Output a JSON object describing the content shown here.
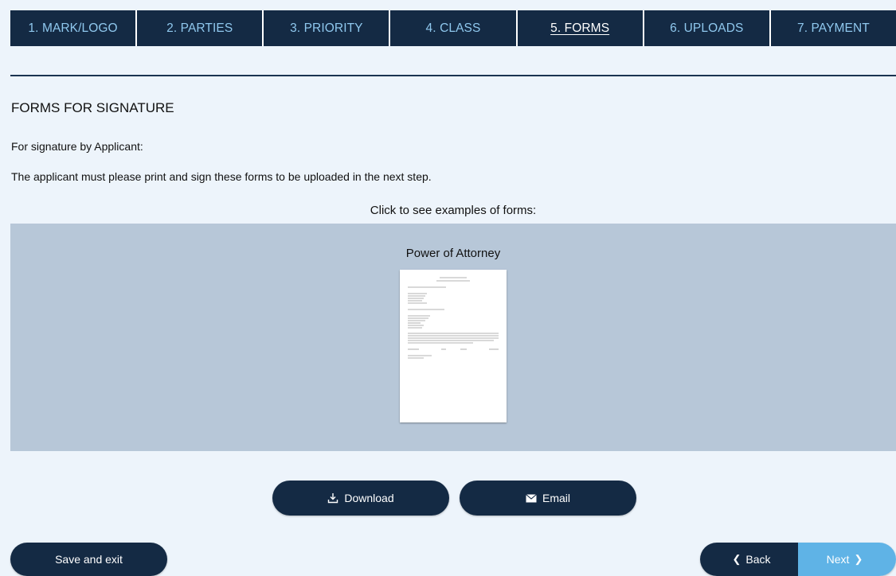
{
  "tabs": [
    {
      "label": "1. MARK/LOGO",
      "active": false
    },
    {
      "label": "2. PARTIES",
      "active": false
    },
    {
      "label": "3. PRIORITY",
      "active": false
    },
    {
      "label": "4. CLASS",
      "active": false
    },
    {
      "label": "5. FORMS",
      "active": true
    },
    {
      "label": "6. UPLOADS",
      "active": false
    },
    {
      "label": "7. PAYMENT",
      "active": false
    }
  ],
  "section": {
    "title": "FORMS FOR SIGNATURE",
    "subheading": "For signature by Applicant:",
    "instructions": "The applicant must please print and sign these forms to be uploaded in the next step.",
    "examples_label": "Click to see examples of forms:"
  },
  "forms": [
    {
      "name": "Power of Attorney"
    }
  ],
  "actions": {
    "download_label": "Download",
    "download_icon": "download-icon",
    "email_label": "Email",
    "email_icon": "envelope-icon"
  },
  "footer": {
    "save_exit_label": "Save and exit",
    "back_label": "Back",
    "next_label": "Next"
  },
  "colors": {
    "navy": "#142a44",
    "tab_text": "#8fc8ee",
    "panel": "#b7c7d8",
    "page_bg": "#edf4fb",
    "next_accent": "#5fb3e6"
  }
}
